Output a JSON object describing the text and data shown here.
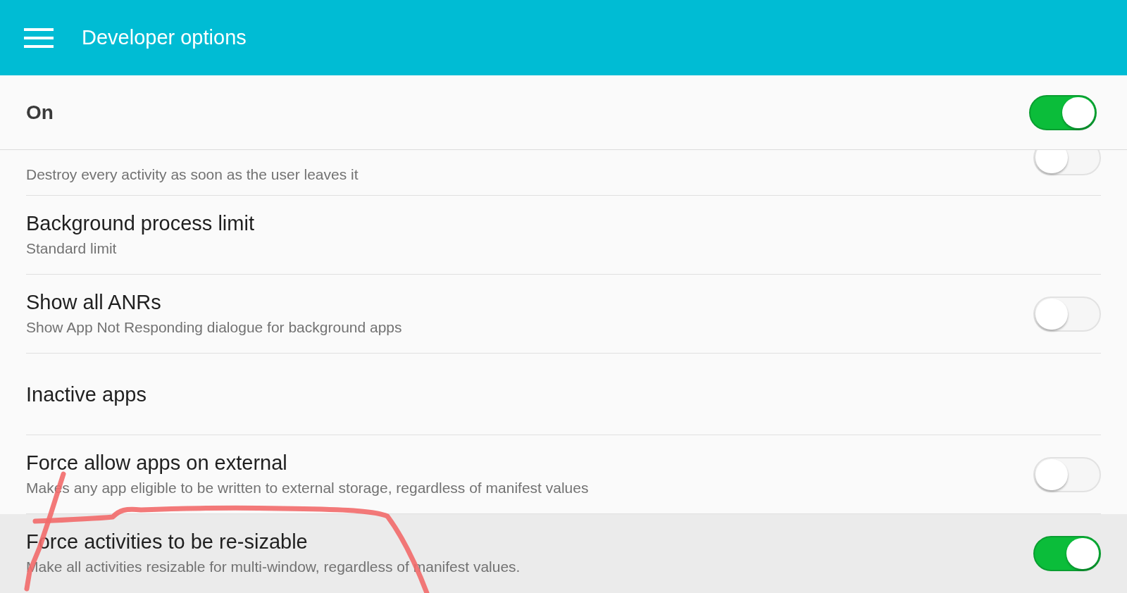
{
  "app_bar": {
    "title": "Developer options"
  },
  "master_switch": {
    "label": "On",
    "on": true
  },
  "settings": [
    {
      "kind": "switch",
      "subtitle": "Destroy every activity as soon as the user leaves it",
      "on": false,
      "highlighted": false
    },
    {
      "kind": "plain",
      "title": "Background process limit",
      "subtitle": "Standard limit",
      "highlighted": false
    },
    {
      "kind": "switch",
      "title": "Show all ANRs",
      "subtitle": "Show App Not Responding dialogue for background apps",
      "on": false,
      "highlighted": false
    },
    {
      "kind": "plain",
      "title": "Inactive apps",
      "highlighted": false
    },
    {
      "kind": "switch",
      "title": "Force allow apps on external",
      "subtitle": "Makes any app eligible to be written to external storage, regardless of manifest values",
      "on": false,
      "highlighted": false
    },
    {
      "kind": "switch",
      "title": "Force activities to be re-sizable",
      "subtitle": "Make all activities resizable for multi-window, regardless of manifest values.",
      "on": true,
      "highlighted": true
    }
  ],
  "markup": {
    "kind": "freehand"
  }
}
